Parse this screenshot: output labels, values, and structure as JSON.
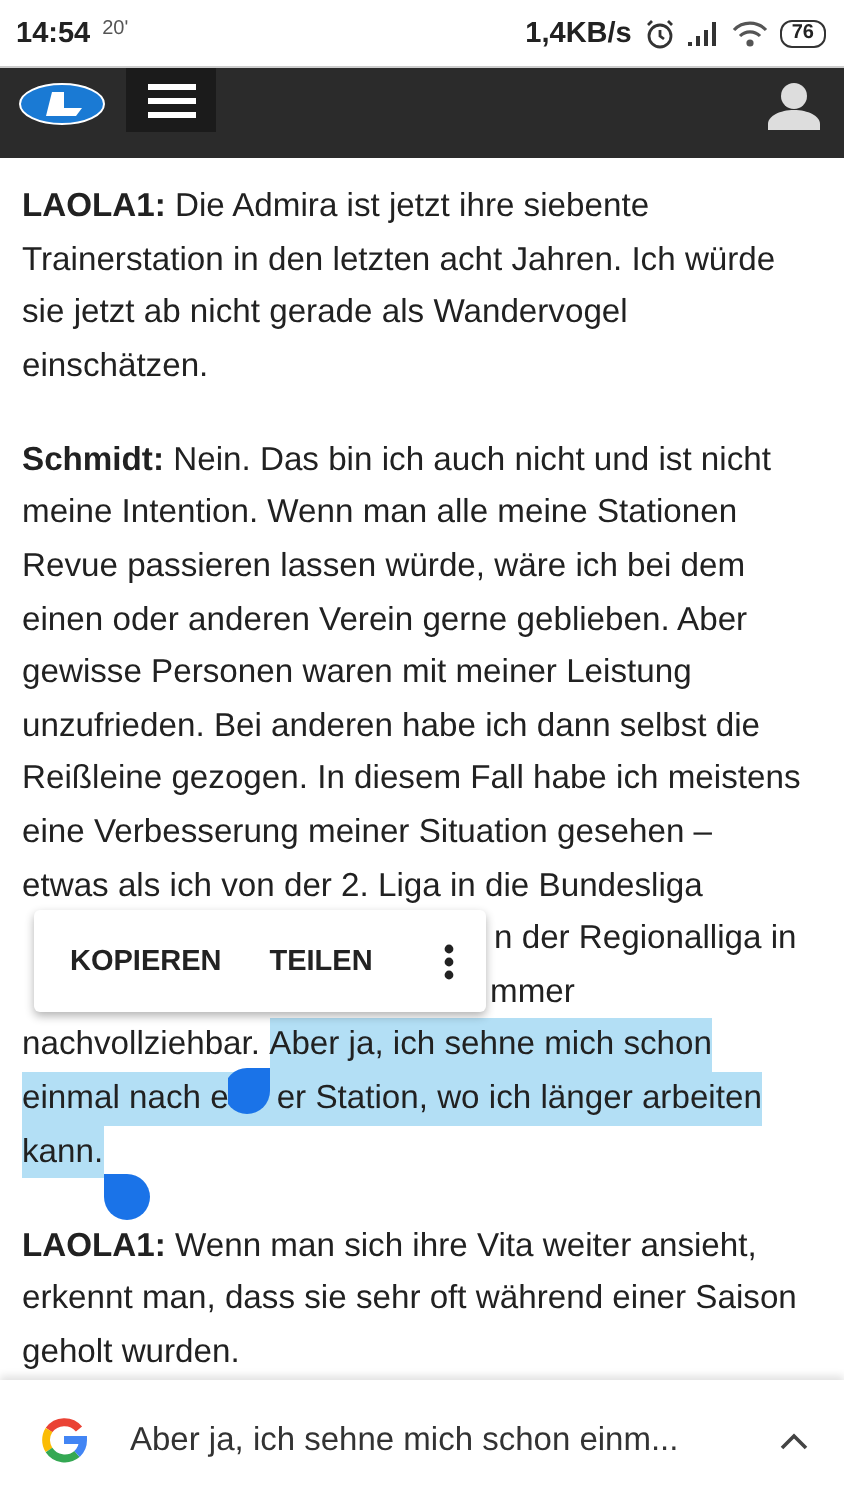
{
  "status_bar": {
    "time": "14:54",
    "temperature": "20'",
    "speed": "1,4KB/s",
    "battery": "76"
  },
  "article": {
    "paragraphs": [
      {
        "blocks": [
          {
            "kind": "text",
            "lines": [
              "**LAOLA1:** Die Admira ist jetzt ihre siebente",
              "Trainerstation in den letzten acht Jahren. Ich würde",
              "sie jetzt ab nicht gerade als Wandervogel",
              "einschätzen."
            ]
          }
        ]
      },
      {
        "blocks": [
          {
            "kind": "text",
            "lines": [
              "**Schmidt:** Nein. Das bin ich auch nicht und ist nicht",
              "meine Intention. Wenn man alle meine Stationen",
              "Revue passieren lassen würde, wäre ich bei dem",
              "einen oder anderen Verein gerne geblieben. Aber",
              "gewisse Personen waren mit meiner Leistung",
              "unzufrieden. Bei anderen habe ich dann selbst die",
              "Reißleine gezogen. In diesem Fall habe ich meistens",
              "eine Verbesserung meiner Situation gesehen –",
              "etwas als ich von der 2. Liga in die Bundesliga"
            ]
          },
          {
            "kind": "line",
            "segments": [
              {
                "kind": "gap"
              },
              {
                "kind": "text",
                "text": "n der Regionalliga in",
                "selected": false
              }
            ]
          },
          {
            "kind": "line",
            "segments": [
              {
                "kind": "gap"
              },
              {
                "kind": "text",
                "text": "mmer",
                "selected": false
              }
            ]
          },
          {
            "kind": "line",
            "segments": [
              {
                "kind": "text",
                "text": "nachvollziehbar. ",
                "selected": false
              },
              {
                "kind": "text",
                "text": "Aber ja, ich sehne mich schon",
                "selected": true
              }
            ]
          },
          {
            "kind": "line",
            "segments": [
              {
                "kind": "text",
                "text": "einmal nach e",
                "selected": true
              },
              {
                "kind": "gap",
                "selected": true
              },
              {
                "kind": "text",
                "text": "er Station, wo ich länger arbeiten",
                "selected": true
              }
            ]
          },
          {
            "kind": "line",
            "segments": [
              {
                "kind": "text",
                "text": "kann.",
                "selected": true
              }
            ]
          }
        ]
      },
      {
        "blocks": [
          {
            "kind": "text",
            "lines": [
              "**LAOLA1:** Wenn man sich ihre Vita weiter ansieht,",
              "erkennt man, dass sie sehr oft während einer Saison",
              "geholt wurden."
            ]
          }
        ]
      }
    ]
  },
  "context_menu": {
    "items": [
      "KOPIEREN",
      "TEILEN"
    ]
  },
  "search_bar": {
    "text": "Aber ja, ich sehne mich schon einm..."
  }
}
